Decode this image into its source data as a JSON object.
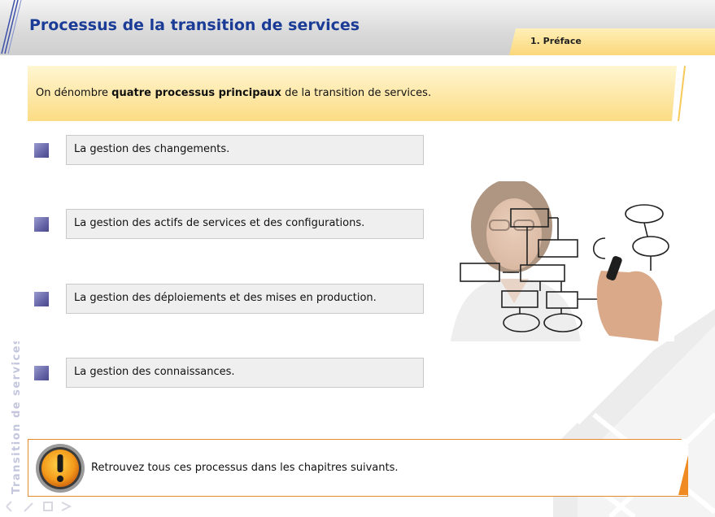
{
  "header": {
    "title": "Processus de la transition de services",
    "chapter": "1. Préface"
  },
  "intro": {
    "before": "On dénombre ",
    "bold": "quatre processus principaux",
    "after": " de la transition de services."
  },
  "processes": [
    {
      "label": "La gestion des changements."
    },
    {
      "label": "La gestion des actifs de services et des configurations."
    },
    {
      "label": "La gestion des déploiements et des mises en production."
    },
    {
      "label": "La gestion des connaissances."
    }
  ],
  "note": {
    "text": "Retrouvez tous ces processus dans les chapitres suivants.",
    "icon": "exclamation-icon"
  },
  "sidebar": {
    "vertical_title": "Transition de services"
  },
  "colors": {
    "title_blue": "#1b3c96",
    "banner_yellow": "#fde9a6",
    "bullet_purple": "#6a6aae",
    "note_border": "#e58a2c"
  }
}
